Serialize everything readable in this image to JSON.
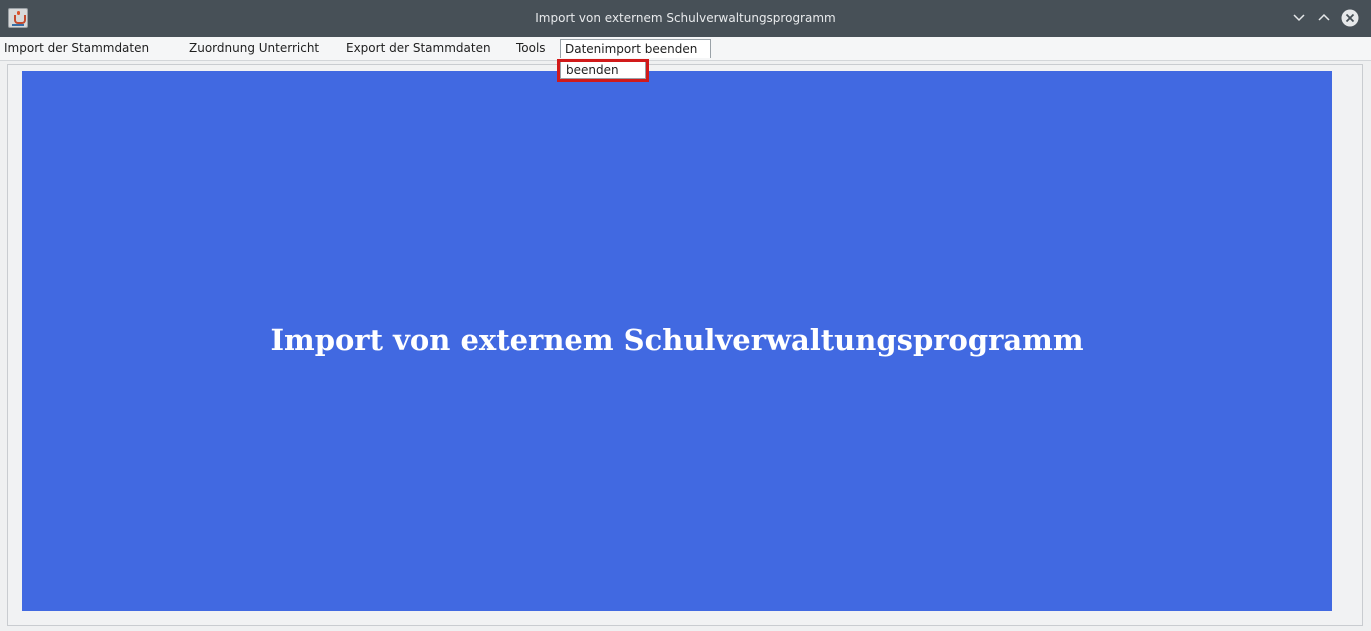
{
  "window": {
    "title": "Import von externem Schulverwaltungsprogramm",
    "app_icon": "java-cup-icon",
    "controls": {
      "minimize_icon": "chevron-down-icon",
      "maximize_icon": "chevron-up-icon",
      "close_icon": "close-circle-icon"
    }
  },
  "menubar": {
    "items": [
      {
        "label": "Import der Stammdaten"
      },
      {
        "label": "Zuordnung Unterricht"
      },
      {
        "label": "Export der Stammdaten"
      },
      {
        "label": "Tools"
      },
      {
        "label": "Datenimport beenden",
        "open": true
      }
    ]
  },
  "dropdown": {
    "items": [
      {
        "label": "beenden"
      }
    ]
  },
  "main": {
    "banner_title": "Import von externem Schulverwaltungsprogramm",
    "banner_color": "#4169e1"
  },
  "colors": {
    "titlebar": "#475057",
    "highlight": "#d11a1a"
  }
}
